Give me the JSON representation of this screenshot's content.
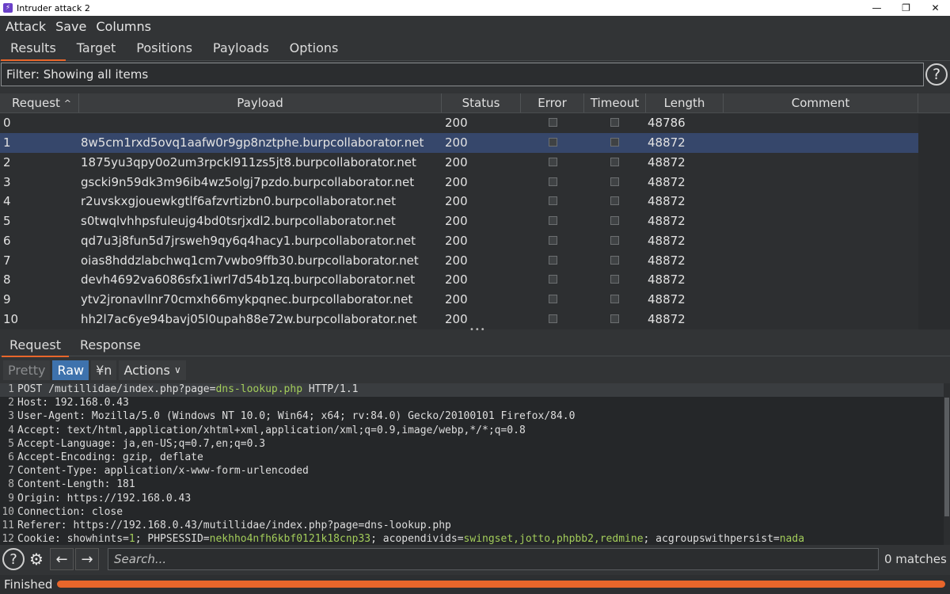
{
  "window": {
    "title": "Intruder attack 2",
    "icon": "burp-icon",
    "controls": [
      "—",
      "❐",
      "✕"
    ]
  },
  "menu": [
    "Attack",
    "Save",
    "Columns"
  ],
  "tabs": [
    "Results",
    "Target",
    "Positions",
    "Payloads",
    "Options"
  ],
  "active_tab": "Results",
  "filter": {
    "text": "Filter: Showing all items"
  },
  "help_label": "?",
  "table": {
    "columns": [
      "Request",
      "Payload",
      "Status",
      "Error",
      "Timeout",
      "Length",
      "Comment"
    ],
    "sort_indicator": "^",
    "rows": [
      {
        "request": "0",
        "payload": "",
        "status": "200",
        "length": "48786"
      },
      {
        "request": "1",
        "payload": "8w5cm1rxd5ovq1aafw0r9gp8nztphe.burpcollaborator.net",
        "status": "200",
        "length": "48872"
      },
      {
        "request": "2",
        "payload": "1875yu3qpy0o2um3rpckl911zs5jt8.burpcollaborator.net",
        "status": "200",
        "length": "48872"
      },
      {
        "request": "3",
        "payload": "gscki9n59dk3m96ib4wz5olgj7pzdo.burpcollaborator.net",
        "status": "200",
        "length": "48872"
      },
      {
        "request": "4",
        "payload": "r2uvskxgjouewkgtlf6afzvrtizbn0.burpcollaborator.net",
        "status": "200",
        "length": "48872"
      },
      {
        "request": "5",
        "payload": "s0twqlvhhpsfuleujg4bd0tsrjxdl2.burpcollaborator.net",
        "status": "200",
        "length": "48872"
      },
      {
        "request": "6",
        "payload": "qd7u3j8fun5d7jrsweh9qy6q4hacy1.burpcollaborator.net",
        "status": "200",
        "length": "48872"
      },
      {
        "request": "7",
        "payload": "oias8hddzlabchwq1cm7vwbo9ffb30.burpcollaborator.net",
        "status": "200",
        "length": "48872"
      },
      {
        "request": "8",
        "payload": "devh4692va6086sfx1iwrl7d54b1zq.burpcollaborator.net",
        "status": "200",
        "length": "48872"
      },
      {
        "request": "9",
        "payload": "ytv2jronavllnr70cmxh66mykpqnec.burpcollaborator.net",
        "status": "200",
        "length": "48872"
      },
      {
        "request": "10",
        "payload": "hh2l7ac6ye94bavj05l0upah88e72w.burpcollaborator.net",
        "status": "200",
        "length": "48872"
      }
    ],
    "selected_row": 1
  },
  "divider": "•••",
  "subtabs": [
    "Request",
    "Response"
  ],
  "active_subtab": "Request",
  "toolbar": {
    "pretty": "Pretty",
    "raw": "Raw",
    "newline": "¥n",
    "actions": "Actions",
    "actions_icon": "chevron-down-icon"
  },
  "editor": {
    "lines": [
      {
        "n": "1",
        "parts": [
          [
            "POST /mutillidae/index.php?page=",
            ""
          ],
          [
            "dns-lookup.php",
            "hl"
          ],
          [
            " HTTP/1.1",
            ""
          ]
        ]
      },
      {
        "n": "2",
        "parts": [
          [
            "Host: 192.168.0.43",
            ""
          ]
        ]
      },
      {
        "n": "3",
        "parts": [
          [
            "User-Agent: Mozilla/5.0 (Windows NT 10.0; Win64; x64; rv:84.0) Gecko/20100101 Firefox/84.0",
            ""
          ]
        ]
      },
      {
        "n": "4",
        "parts": [
          [
            "Accept: text/html,application/xhtml+xml,application/xml;q=0.9,image/webp,*/*;q=0.8",
            ""
          ]
        ]
      },
      {
        "n": "5",
        "parts": [
          [
            "Accept-Language: ja,en-US;q=0.7,en;q=0.3",
            ""
          ]
        ]
      },
      {
        "n": "6",
        "parts": [
          [
            "Accept-Encoding: gzip, deflate",
            ""
          ]
        ]
      },
      {
        "n": "7",
        "parts": [
          [
            "Content-Type: application/x-www-form-urlencoded",
            ""
          ]
        ]
      },
      {
        "n": "8",
        "parts": [
          [
            "Content-Length: 181",
            ""
          ]
        ]
      },
      {
        "n": "9",
        "parts": [
          [
            "Origin: https://192.168.0.43",
            ""
          ]
        ]
      },
      {
        "n": "10",
        "parts": [
          [
            "Connection: close",
            ""
          ]
        ]
      },
      {
        "n": "11",
        "parts": [
          [
            "Referer: https://192.168.0.43/mutillidae/index.php?page=dns-lookup.php",
            ""
          ]
        ]
      },
      {
        "n": "12",
        "parts": [
          [
            "Cookie: showhints=",
            ""
          ],
          [
            "1",
            "hl"
          ],
          [
            "; PHPSESSID=",
            ""
          ],
          [
            "nekhho4nfh6kbf0121k18cnp33",
            "hl"
          ],
          [
            "; acopendivids=",
            ""
          ],
          [
            "swingset,jotto,phpbb2,redmine",
            "hl"
          ],
          [
            "; acgroupswithpersist=",
            ""
          ],
          [
            "nada",
            "hl"
          ]
        ]
      }
    ]
  },
  "search": {
    "placeholder": "Search...",
    "matches": "0 matches",
    "help": "?",
    "gear_icon": "gear-icon",
    "back_icon": "arrow-left-icon",
    "forward_icon": "arrow-right-icon"
  },
  "status": {
    "label": "Finished",
    "progress": 1.0,
    "progress_color": "#e8662b"
  },
  "colors": {
    "accent": "#e8662b",
    "selected_row": "#36476b",
    "raw_button": "#3e72ad",
    "highlight": "#a3cd5a"
  }
}
